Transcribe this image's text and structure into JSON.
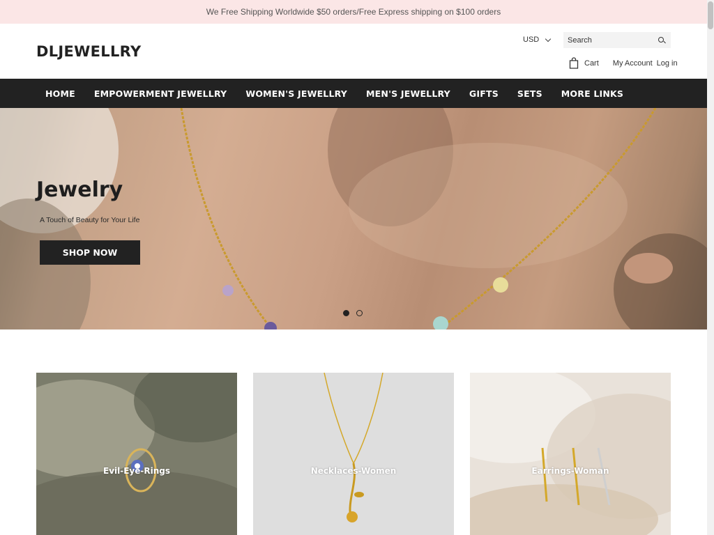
{
  "announcement": "We Free Shipping Worldwide $50 orders/Free Express shipping on $100 orders",
  "header": {
    "logo": "DLJEWELLRY",
    "currency": "USD",
    "search_placeholder": "Search",
    "cart_label": "Cart",
    "my_account_label": "My Account",
    "login_label": "Log in"
  },
  "nav": {
    "items": [
      {
        "label": "HOME"
      },
      {
        "label": "EMPOWERMENT JEWELLRY"
      },
      {
        "label": "WOMEN'S JEWELLRY"
      },
      {
        "label": "MEN'S JEWELLRY"
      },
      {
        "label": "GIFTS"
      },
      {
        "label": "SETS"
      },
      {
        "label": "MORE LINKS"
      }
    ]
  },
  "hero": {
    "title": "Jewelry",
    "subtitle": "A Touch of Beauty for Your Life",
    "button_label": "SHOP NOW",
    "slides_total": 2,
    "active_slide": 1
  },
  "collections": [
    {
      "label": "Evil-Eye-Rings"
    },
    {
      "label": "Necklaces-Women"
    },
    {
      "label": "Earrings-Woman"
    }
  ],
  "colors": {
    "announcement_bg": "#fbe6e6",
    "nav_bg": "#222222",
    "accent": "#222222"
  }
}
